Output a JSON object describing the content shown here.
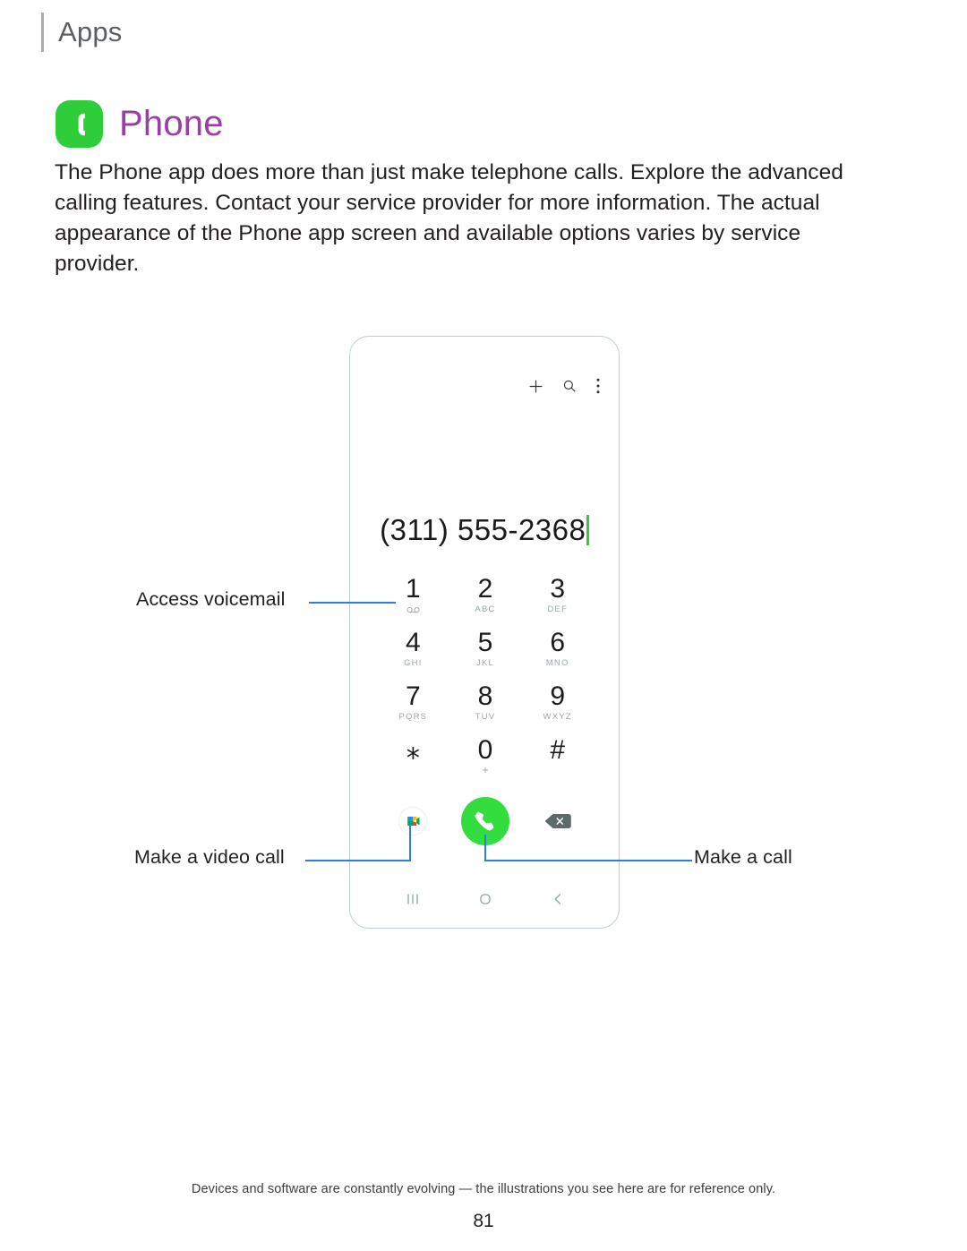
{
  "header": {
    "section_label": "Apps"
  },
  "title": {
    "text": "Phone",
    "icon": "phone-handset-icon",
    "icon_bg_color": "#2dce3a",
    "text_color": "#9a3fa5"
  },
  "intro": {
    "paragraph": "The Phone app does more than just make telephone calls. Explore the advanced calling features. Contact your service provider for more information. The actual appearance of the Phone app screen and available options varies by service provider."
  },
  "phone_mock": {
    "toolbar": [
      {
        "name": "add-contact-icon",
        "label": "+"
      },
      {
        "name": "search-icon",
        "label": "Search"
      },
      {
        "name": "more-options-icon",
        "label": "More options"
      }
    ],
    "dialed_number": "(311) 555-2368",
    "caret_color": "#2dce3a",
    "keypad": [
      {
        "digit": "1",
        "sub": "",
        "icon": "voicemail-icon"
      },
      {
        "digit": "2",
        "sub": "ABC",
        "icon": ""
      },
      {
        "digit": "3",
        "sub": "DEF",
        "icon": ""
      },
      {
        "digit": "4",
        "sub": "GHI",
        "icon": ""
      },
      {
        "digit": "5",
        "sub": "JKL",
        "icon": ""
      },
      {
        "digit": "6",
        "sub": "MNO",
        "icon": ""
      },
      {
        "digit": "7",
        "sub": "PQRS",
        "icon": ""
      },
      {
        "digit": "8",
        "sub": "TUV",
        "icon": ""
      },
      {
        "digit": "9",
        "sub": "WXYZ",
        "icon": ""
      },
      {
        "digit": "⁎",
        "sub": "",
        "icon": ""
      },
      {
        "digit": "0",
        "sub": "+",
        "icon": ""
      },
      {
        "digit": "#",
        "sub": "",
        "icon": ""
      }
    ],
    "actions": [
      {
        "name": "video-call-button",
        "label": "Video call",
        "icon": "google-meet-icon"
      },
      {
        "name": "call-button",
        "label": "Call",
        "icon": "phone-handset-icon",
        "color": "#33dd3d"
      },
      {
        "name": "backspace-button",
        "label": "Backspace",
        "icon": "backspace-icon",
        "color": "#5c6b68"
      }
    ],
    "navbar": [
      {
        "name": "recents-button",
        "icon": "recents-icon"
      },
      {
        "name": "home-button",
        "icon": "home-icon"
      },
      {
        "name": "back-button",
        "icon": "back-chevron-icon"
      }
    ]
  },
  "callouts": [
    {
      "name": "callout-access-voicemail",
      "label": "Access voicemail"
    },
    {
      "name": "callout-make-a-video-call",
      "label": "Make a video call"
    },
    {
      "name": "callout-make-a-call",
      "label": "Make a call"
    }
  ],
  "footer": {
    "note": "Devices and software are constantly evolving — the illustrations you see here are for reference only.",
    "page_number": "81"
  },
  "colors": {
    "leader_line": "#2b7fe0",
    "phone_frame": "#bcd0d2",
    "sub_label": "#9aa7ad"
  }
}
